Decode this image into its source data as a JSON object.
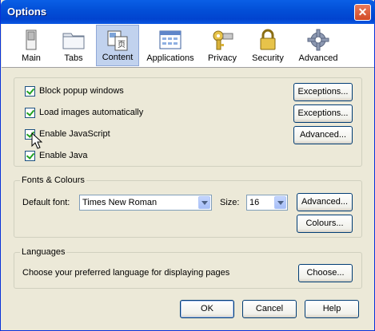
{
  "window": {
    "title": "Options",
    "close_glyph": "✕"
  },
  "tabs": [
    {
      "label": "Main",
      "icon": "switch-icon",
      "selected": false
    },
    {
      "label": "Tabs",
      "icon": "folder-tabs-icon",
      "selected": false
    },
    {
      "label": "Content",
      "icon": "content-page-icon",
      "selected": true
    },
    {
      "label": "Applications",
      "icon": "applications-icon",
      "selected": false
    },
    {
      "label": "Privacy",
      "icon": "key-icon",
      "selected": false
    },
    {
      "label": "Security",
      "icon": "lock-icon",
      "selected": false
    },
    {
      "label": "Advanced",
      "icon": "gear-icon",
      "selected": false
    }
  ],
  "content": {
    "checkboxes": [
      {
        "label": "Block popup windows",
        "checked": true,
        "button": "Exceptions..."
      },
      {
        "label": "Load images automatically",
        "checked": true,
        "button": "Exceptions..."
      },
      {
        "label": "Enable JavaScript",
        "checked": true,
        "button": "Advanced..."
      },
      {
        "label": "Enable Java",
        "checked": true
      }
    ]
  },
  "fonts": {
    "legend": "Fonts & Colours",
    "default_font_label": "Default font:",
    "default_font_value": "Times New Roman",
    "size_label": "Size:",
    "size_value": "16",
    "advanced_button": "Advanced...",
    "colours_button": "Colours..."
  },
  "languages": {
    "legend": "Languages",
    "description": "Choose your preferred language for displaying pages",
    "choose_button": "Choose..."
  },
  "footer": {
    "ok": "OK",
    "cancel": "Cancel",
    "help": "Help"
  }
}
